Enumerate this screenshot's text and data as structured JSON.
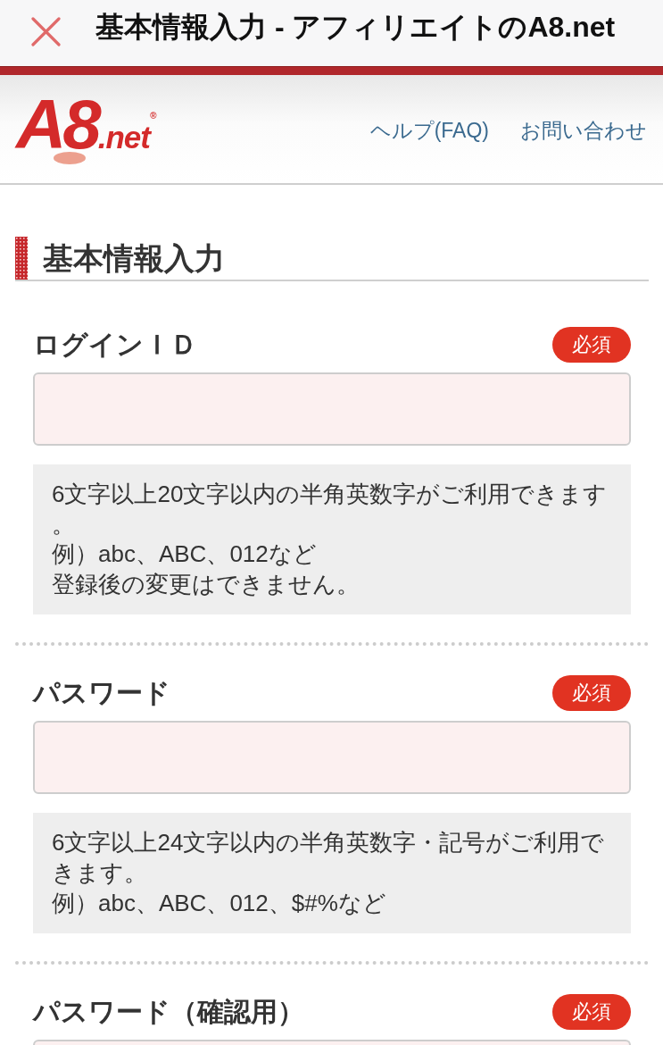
{
  "browser_bar": {
    "title": "基本情報入力 - アフィリエイトのA8.net"
  },
  "header": {
    "logo": "A8$_{.net}$$^{®}$",
    "links": [
      {
        "label": "ヘルプ(FAQ)"
      },
      {
        "label": "お問い合わせ"
      }
    ]
  },
  "section": {
    "title": "基本情報入力"
  },
  "fields": [
    {
      "label": "ログインＩＤ",
      "badge": "必須",
      "hint": [
        "6文字以上20文字以内の半角英数字がご利用できます。",
        "例）abc、ABC、012など",
        "登録後の変更はできません。"
      ]
    },
    {
      "label": "パスワード",
      "badge": "必須",
      "hint": [
        "6文字以上24文字以内の半角英数字・記号がご利用できます。",
        "例）abc、ABC、012、$#%など"
      ]
    },
    {
      "label": "パスワード（確認用）",
      "badge": "必須"
    }
  ]
}
